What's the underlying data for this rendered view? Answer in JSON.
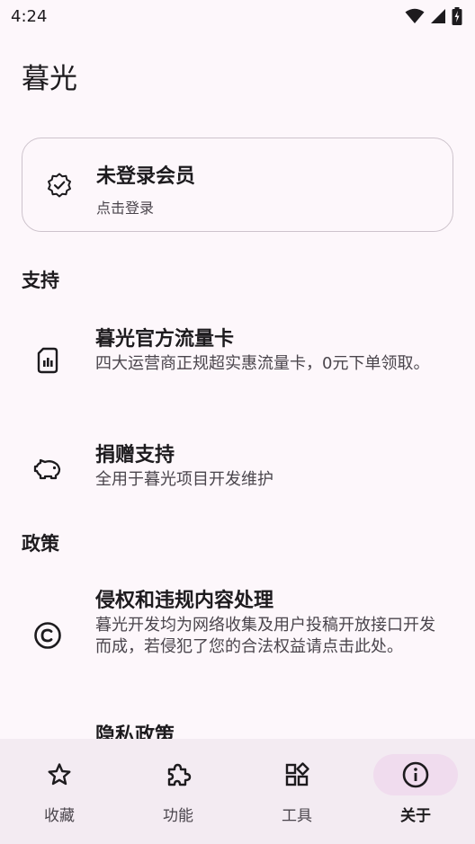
{
  "status_bar": {
    "time": "4:24",
    "icons": [
      "wifi-icon",
      "signal-icon",
      "battery-icon"
    ]
  },
  "page": {
    "title": "暮光"
  },
  "member": {
    "title": "未登录会员",
    "subtitle": "点击登录",
    "icon": "verified-badge-icon"
  },
  "sections": {
    "support": {
      "header": "支持",
      "items": [
        {
          "title": "暮光官方流量卡",
          "desc": "四大运营商正规超实惠流量卡，0元下单领取。",
          "icon": "sim-card-icon"
        },
        {
          "title": "捐赠支持",
          "desc": "全用于暮光项目开发维护",
          "icon": "piggy-bank-icon"
        }
      ]
    },
    "policy": {
      "header": "政策",
      "items": [
        {
          "title": "侵权和违规内容处理",
          "desc": "暮光开发均为网络收集及用户投稿开放接口开发而成，若侵犯了您的合法权益请点击此处。",
          "icon": "copyright-icon"
        },
        {
          "title": "隐私政策",
          "icon": "privacy-icon"
        }
      ]
    }
  },
  "bottom_nav": {
    "items": [
      {
        "label": "收藏",
        "icon": "star-icon",
        "active": false
      },
      {
        "label": "功能",
        "icon": "puzzle-icon",
        "active": false
      },
      {
        "label": "工具",
        "icon": "widgets-icon",
        "active": false
      },
      {
        "label": "关于",
        "icon": "info-icon",
        "active": true
      }
    ]
  },
  "colors": {
    "background": "#fdf7fb",
    "nav_background": "#f3ebf2",
    "active_pill": "#f0dcee",
    "text_primary": "#1d1b1e",
    "text_secondary": "#4a454c"
  }
}
